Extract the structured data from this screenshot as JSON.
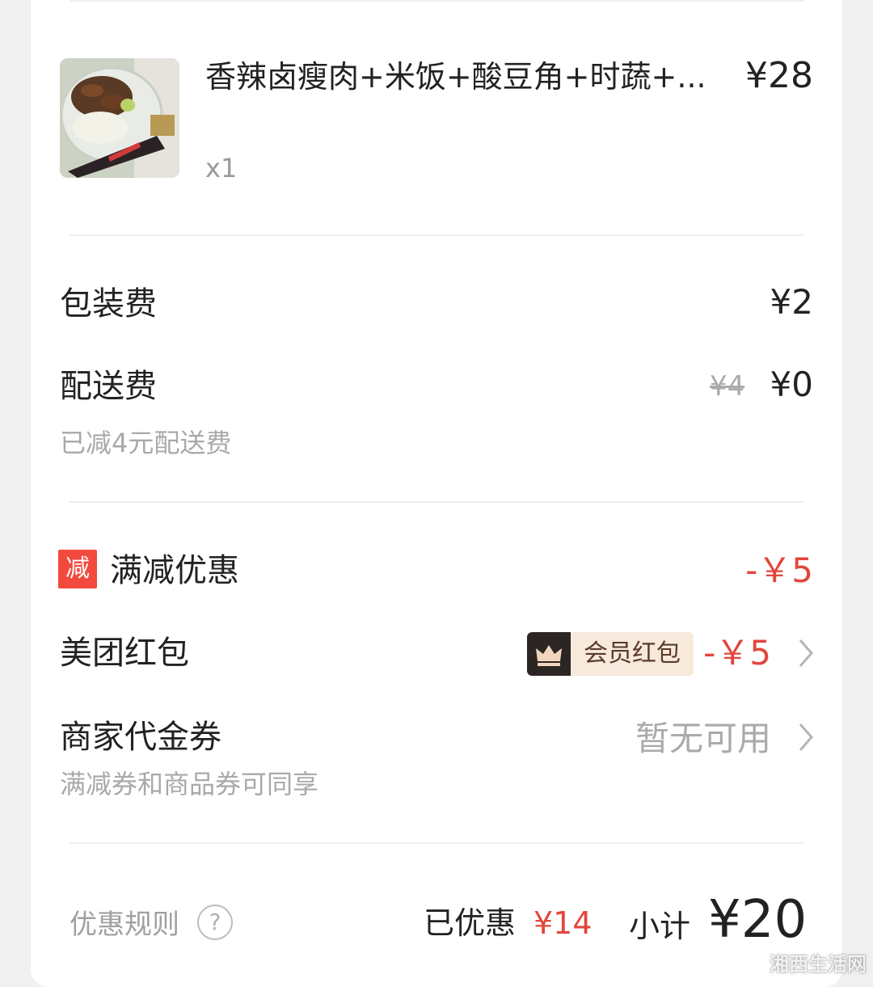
{
  "product": {
    "name": "香辣卤瘦肉+米饭+酸豆角+时蔬+...",
    "price": "¥28",
    "quantity": "x1",
    "image_icon": "food-photo"
  },
  "fees": {
    "packaging": {
      "label": "包装费",
      "value": "¥2"
    },
    "delivery": {
      "label": "配送费",
      "original": "¥4",
      "value": "¥0",
      "note": "已减4元配送费"
    }
  },
  "discounts": {
    "full_reduction": {
      "badge": "减",
      "label": "满减优惠",
      "value": "-￥5"
    },
    "meituan_hongbao": {
      "label": "美团红包",
      "member_tag": "会员红包",
      "value": "-￥5"
    },
    "merchant_voucher": {
      "label": "商家代金券",
      "note": "满减券和商品券可同享",
      "value": "暂无可用"
    }
  },
  "footer": {
    "rule_label": "优惠规则",
    "help_symbol": "?",
    "discounted_label": "已优惠",
    "discounted_value": "¥14",
    "subtotal_label": "小计",
    "subtotal_value": "¥20"
  },
  "colors": {
    "accent_red": "#e2463c",
    "badge_red": "#f24a3d",
    "member_bg": "#f7e9dc",
    "member_dark": "#2b2523"
  },
  "watermark": "湘西生活网"
}
